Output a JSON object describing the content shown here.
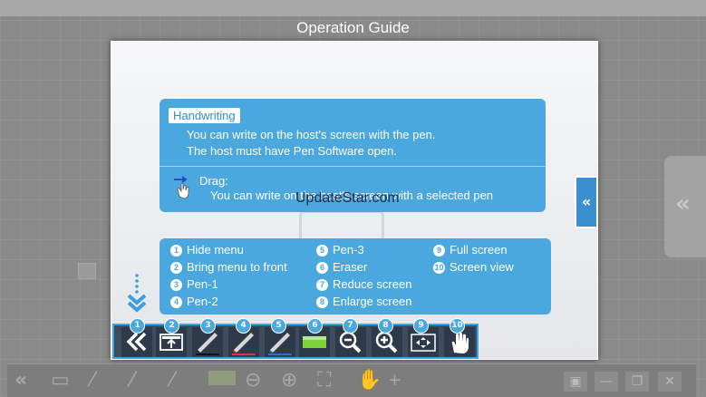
{
  "title": "Operation Guide",
  "handwriting": {
    "badge": "Handwriting",
    "line1": "You can write on the host's screen with the pen.",
    "line2": "The host must have Pen Software open."
  },
  "drag": {
    "title": "Drag:",
    "description": "You can write on the host's screen with a selected pen"
  },
  "watermark": "UpdateStar.com",
  "side_tab_label": "«",
  "legend": [
    {
      "num": "1",
      "label": "Hide menu"
    },
    {
      "num": "2",
      "label": "Bring menu to front"
    },
    {
      "num": "3",
      "label": "Pen-1"
    },
    {
      "num": "4",
      "label": "Pen-2"
    },
    {
      "num": "5",
      "label": "Pen-3"
    },
    {
      "num": "6",
      "label": "Eraser"
    },
    {
      "num": "7",
      "label": "Reduce screen"
    },
    {
      "num": "8",
      "label": "Enlarge screen"
    },
    {
      "num": "9",
      "label": "Full screen"
    },
    {
      "num": "10",
      "label": "Screen view"
    }
  ],
  "toolbar": {
    "tools": [
      {
        "num": "1",
        "icon": "double-chevron-left-icon"
      },
      {
        "num": "2",
        "icon": "bring-to-front-icon"
      },
      {
        "num": "3",
        "icon": "pen-black-icon"
      },
      {
        "num": "4",
        "icon": "pen-red-icon"
      },
      {
        "num": "5",
        "icon": "pen-blue-icon"
      },
      {
        "num": "6",
        "icon": "eraser-icon"
      },
      {
        "num": "7",
        "icon": "zoom-out-icon"
      },
      {
        "num": "8",
        "icon": "zoom-in-icon"
      },
      {
        "num": "9",
        "icon": "full-screen-icon"
      },
      {
        "num": "10",
        "icon": "hand-icon"
      }
    ]
  },
  "colors": {
    "accent": "#4aa8de",
    "toolbar_bg": "#3e4c5e",
    "pen_red": "#d83a3a",
    "pen_blue": "#2f6fd8",
    "eraser": "#7ed23a"
  }
}
